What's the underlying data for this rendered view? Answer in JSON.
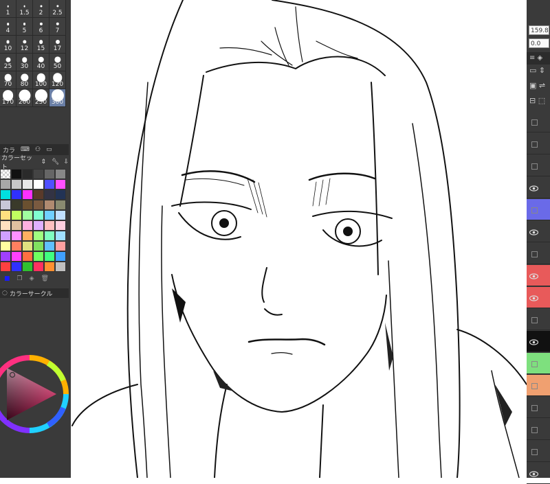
{
  "brush_sizes": [
    "1",
    "1.5",
    "2",
    "2.5",
    "4",
    "5",
    "6",
    "7",
    "10",
    "12",
    "15",
    "17",
    "25",
    "30",
    "40",
    "50",
    "70",
    "80",
    "100",
    "120",
    "170",
    "200",
    "250",
    "300"
  ],
  "tabs": {
    "palette_tab": "カラ"
  },
  "color_set": {
    "label": "カラーセット"
  },
  "color_circle": {
    "label": "カラーサークル"
  },
  "swatch_colors": [
    "checker",
    "#111111",
    "#2a2a2a",
    "#444444",
    "#666666",
    "#888888",
    "#a8a8a8",
    "#c8c8c8",
    "#e8e8e8",
    "#ffffff",
    "#5050ff",
    "#ff50ff",
    "#00e0e0",
    "#3030ff",
    "#ff30ff",
    "#5a3a2a",
    "#333344",
    "#223355",
    "#c8c8d8",
    "#3a3a2a",
    "#6a5030",
    "#7a5a40",
    "#b08a70",
    "#8a8a70",
    "#ffe080",
    "#c0ff60",
    "#a0ffa0",
    "#80ffd0",
    "#70d0ff",
    "#c0e0ff",
    "#ffe0c0",
    "#e0c0a0",
    "#ffb0e0",
    "#e0b0ff",
    "#ffc0c0",
    "#ffd0e0",
    "#d0a0ff",
    "#ff90ff",
    "#ffb060",
    "#a0ff80",
    "#80ffc0",
    "#a0e0ff",
    "#ffffa0",
    "#ff8060",
    "#e0e080",
    "#80e060",
    "#60c0ff",
    "#ffa0a0",
    "#a040ff",
    "#ff40ff",
    "#ff7040",
    "#70ff60",
    "#40ff80",
    "#40a0ff",
    "#ff4040",
    "#3030ff",
    "#30c030",
    "#ff3060",
    "#ff9030",
    "#c0c0c0"
  ],
  "right_panel": {
    "value_1": "159.8",
    "value_2": "0.0"
  },
  "layers": [
    {
      "visible": false,
      "color": ""
    },
    {
      "visible": false,
      "color": ""
    },
    {
      "visible": false,
      "color": ""
    },
    {
      "visible": true,
      "color": ""
    },
    {
      "visible": false,
      "color": "#6a6ae8"
    },
    {
      "visible": true,
      "color": ""
    },
    {
      "visible": false,
      "color": ""
    },
    {
      "visible": true,
      "color": "#e85a5a"
    },
    {
      "visible": true,
      "color": "#e85a5a"
    },
    {
      "visible": false,
      "color": ""
    },
    {
      "visible": true,
      "color": "#111111"
    },
    {
      "visible": false,
      "color": "#7ee07e"
    },
    {
      "visible": false,
      "color": "#f0a070"
    },
    {
      "visible": false,
      "color": ""
    },
    {
      "visible": false,
      "color": ""
    },
    {
      "visible": false,
      "color": ""
    },
    {
      "visible": true,
      "color": ""
    }
  ]
}
